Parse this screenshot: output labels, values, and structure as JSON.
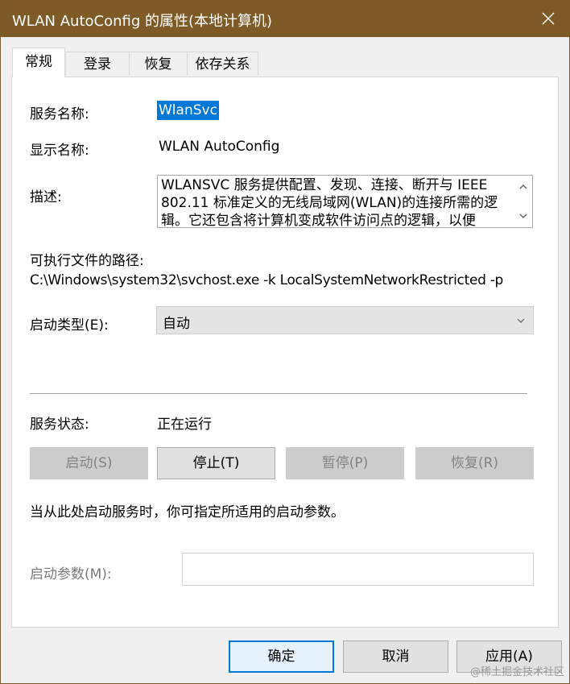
{
  "window": {
    "title": "WLAN AutoConfig 的属性(本地计算机)"
  },
  "tabs": [
    {
      "label": "常规",
      "active": true
    },
    {
      "label": "登录",
      "active": false
    },
    {
      "label": "恢复",
      "active": false
    },
    {
      "label": "依存关系",
      "active": false
    }
  ],
  "general": {
    "service_name_label": "服务名称:",
    "service_name_value": "WlanSvc",
    "display_name_label": "显示名称:",
    "display_name_value": "WLAN AutoConfig",
    "description_label": "描述:",
    "description_value": "WLANSVC 服务提供配置、发现、连接、断开与 IEEE 802.11 标准定义的无线局域网(WLAN)的连接所需的逻辑。它还包含将计算机变成软件访问点的逻辑，以便",
    "path_label": "可执行文件的路径:",
    "path_value": "C:\\Windows\\system32\\svchost.exe -k LocalSystemNetworkRestricted -p",
    "startup_type_label": "启动类型(E):",
    "startup_type_value": "自动",
    "service_status_label": "服务状态:",
    "service_status_value": "正在运行",
    "start_button": "启动(S)",
    "stop_button": "停止(T)",
    "pause_button": "暂停(P)",
    "resume_button": "恢复(R)",
    "hint_text": "当从此处启动服务时，你可指定所适用的启动参数。",
    "start_params_label": "启动参数(M):",
    "start_params_value": ""
  },
  "footer": {
    "ok_button": "确定",
    "cancel_button": "取消",
    "apply_button": "应用(A)"
  },
  "watermark": "@稀土掘金技术社区",
  "colors": {
    "titlebar": "#7d5a26",
    "selection": "#0078d7",
    "default_button_border": "#0078d7"
  }
}
